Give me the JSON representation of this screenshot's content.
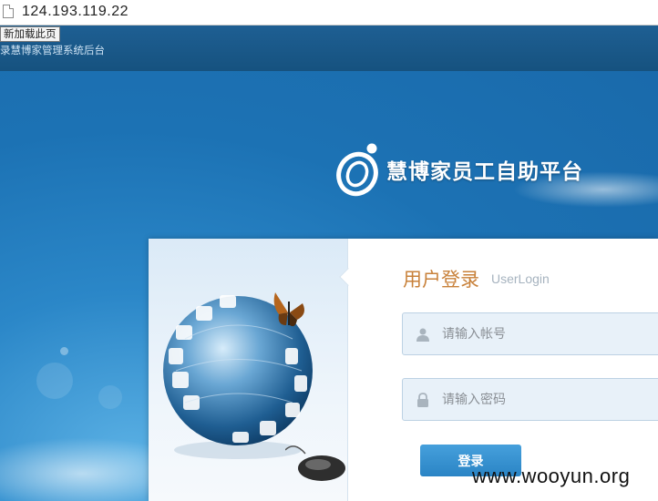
{
  "browser": {
    "url": "124.193.119.22",
    "tooltip": "新加载此页"
  },
  "header": {
    "system_title": "录慧博家管理系统后台"
  },
  "brand": {
    "name": "慧博家员工自助平台"
  },
  "login": {
    "title": "用户登录",
    "subtitle": "UserLogin",
    "username_placeholder": "请输入帐号",
    "password_placeholder": "请输入密码",
    "submit_label": "登录"
  },
  "watermark": "www.wooyun.org",
  "colors": {
    "accent": "#2a84c5",
    "title": "#c8813a",
    "background": "#1b6fae"
  },
  "icons": [
    "document-icon",
    "brand-logo-icon",
    "user-icon",
    "lock-icon",
    "globe-illustration",
    "butterfly-illustration",
    "mouse-illustration"
  ]
}
